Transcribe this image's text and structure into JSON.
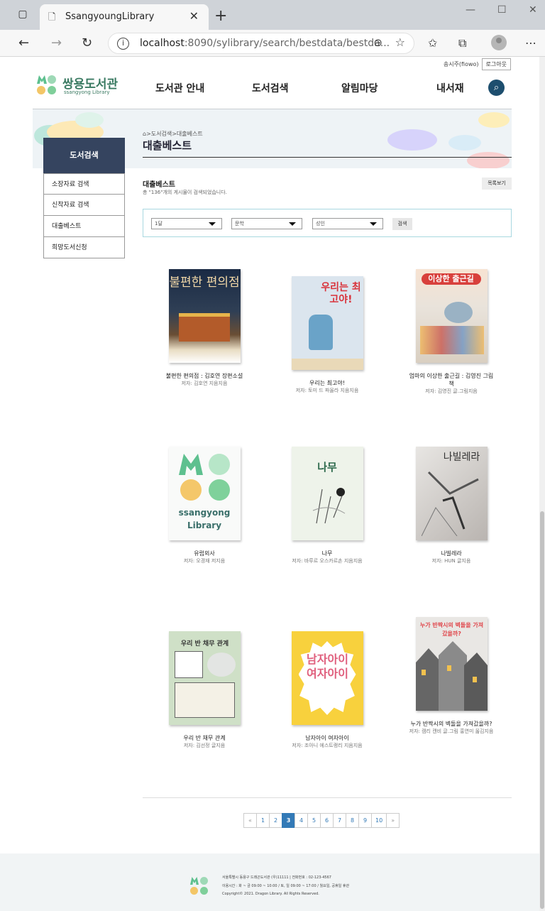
{
  "browser": {
    "tab_title": "SsangyoungLibrary",
    "url_host": "localhost",
    "url_rest": ":8090/sylibrary/search/bestdata/bestda..."
  },
  "header": {
    "user_name": "송시주(fiowo)",
    "logout_label": "로그아웃",
    "logo_name": "쌍용도서관",
    "logo_sub": "ssangyong Library",
    "nav": [
      "도서관 안내",
      "도서검색",
      "알림마당",
      "내서재"
    ]
  },
  "hero": {
    "breadcrumb": ">도서검색>대출베스트",
    "title": "대출베스트"
  },
  "sidebar": {
    "heading": "도서검색",
    "items": [
      "소장자료 검색",
      "신착자료 검색",
      "대출베스트",
      "희망도서신청"
    ]
  },
  "section": {
    "title": "대출베스트",
    "count_text": "총 \"136\"개의 게시물이 검색되었습니다.",
    "list_button": "목록보기"
  },
  "filter": {
    "period": "1달",
    "genre": "문학",
    "age": "성인",
    "search_button": "검색"
  },
  "books": [
    {
      "title": "불편한 편의점 : 김호연 장편소설",
      "author": "저자: 김호연 지음지음",
      "cover_text": "불편한 편의점"
    },
    {
      "title": "우리는 최고야!",
      "author": "저자: 토미 드 파올라 지음지음",
      "cover_text": "우리는 최고야!"
    },
    {
      "title": "엄마의 이상한 출근길 : 김영진 그림책",
      "author": "저자: 김영진 글.그림지음",
      "cover_text": "이상한 출근길"
    },
    {
      "title": "유럽외사",
      "author": "저자: 오경재 저지음",
      "cover_text": "ssangyong Library"
    },
    {
      "title": "나무",
      "author": "저자: 바루르 오스카르손 지음지음",
      "cover_text": "나무"
    },
    {
      "title": "나빌레라",
      "author": "저자: HUN 글지음",
      "cover_text": "나빌레라"
    },
    {
      "title": "우리 반 채무 관계",
      "author": "저자: 김선정 글지음",
      "cover_text": "우리 반 채무 관계"
    },
    {
      "title": "남자아이 여자아이",
      "author": "저자: 조아니 에스트랭리 지음지음",
      "cover_text": "남자아이 여자아이"
    },
    {
      "title": "누가 반짝시의 벽돌을 가져갔을까?",
      "author": "저자: 캠리 캔비 글.그림 홍연미 옮김지음",
      "cover_text": "누가 반짝시의 벽돌을 가져갔을까?"
    }
  ],
  "pagination": {
    "prev": "«",
    "pages": [
      "1",
      "2",
      "3",
      "4",
      "5",
      "6",
      "7",
      "8",
      "9",
      "10"
    ],
    "active": "3",
    "next": "»"
  },
  "footer": {
    "address": "서울특별시 동용구 드래곤도서관 (우)11111 | 전화번호 : 02-123-4567",
    "hours": "이용시간 : 화 ~ 금 09:00 ~ 10:00 / 토, 일 09:00 ~ 17:00 / 월요일, 공휴일 휴관",
    "copyright": "Copyright© 2021. Dragon Library. All Rights Reserved."
  },
  "colors": {
    "sidebar_head": "#35445f",
    "logo_green": "#3a7a62",
    "accent_blue": "#337ab7",
    "search_btn": "#1d4e6e"
  }
}
